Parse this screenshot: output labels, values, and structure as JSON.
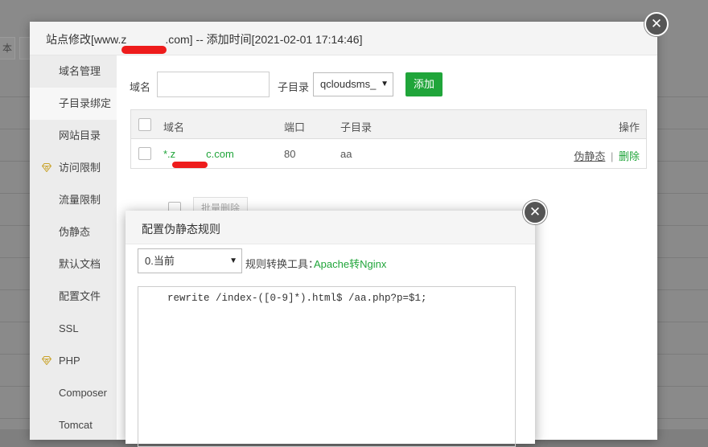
{
  "background": {
    "partial_button_label": "本"
  },
  "dialog": {
    "title": "站点修改[www.zs.com] -- 添加时间[2021-02-01 17:14:46]",
    "title_prefix": "站点修改[www.z",
    "title_suffix": ".com] -- 添加时间[2021-02-01 17:14:46]",
    "close_symbol": "✕"
  },
  "sidebar": {
    "items": [
      {
        "label": "域名管理",
        "vip": false
      },
      {
        "label": "子目录绑定",
        "vip": false,
        "active": true
      },
      {
        "label": "网站目录",
        "vip": false
      },
      {
        "label": "访问限制",
        "vip": true
      },
      {
        "label": "流量限制",
        "vip": false
      },
      {
        "label": "伪静态",
        "vip": false
      },
      {
        "label": "默认文档",
        "vip": false
      },
      {
        "label": "配置文件",
        "vip": false
      },
      {
        "label": "SSL",
        "vip": false
      },
      {
        "label": "PHP",
        "vip": true
      },
      {
        "label": "Composer",
        "vip": false
      },
      {
        "label": "Tomcat",
        "vip": false
      }
    ]
  },
  "form": {
    "domain_label": "域名",
    "domain_value": "",
    "subdir_label": "子目录",
    "subdir_selected": "qcloudsms_",
    "add_button": "添加"
  },
  "table": {
    "headers": {
      "domain": "域名",
      "port": "端口",
      "subdir": "子目录",
      "actions": "操作"
    },
    "rows": [
      {
        "domain_prefix": "*.z",
        "domain_suffix": "c.com",
        "port": "80",
        "subdir": "aa",
        "action_rewrite": "伪静态",
        "separator": "|",
        "action_delete": "删除"
      }
    ],
    "batch_delete": "批量删除"
  },
  "modal": {
    "title": "配置伪静态规则",
    "close_symbol": "✕",
    "version_selected": "0.当前",
    "tool_label": "规则转换工具：",
    "tool_link": "Apache转Nginx",
    "rule_text": "rewrite /index-([0-9]*).html$ /aa.php?p=$1;"
  },
  "colors": {
    "accent": "#20a53a",
    "redaction": "#ee1c1c",
    "vip_gold": "#c9a227"
  }
}
